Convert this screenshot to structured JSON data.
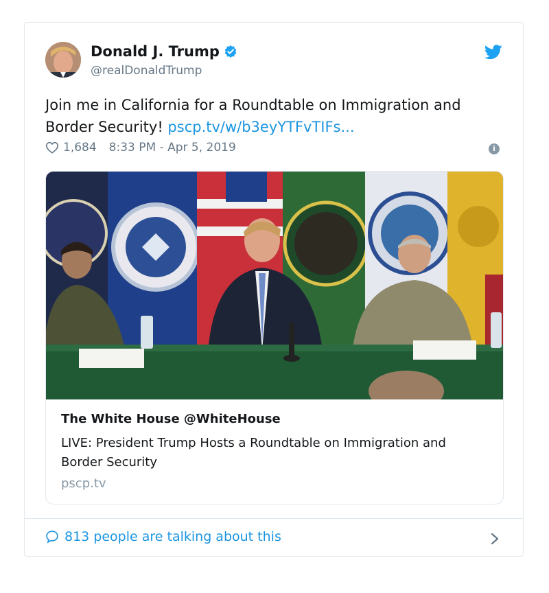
{
  "tweet": {
    "author_name": "Donald J. Trump",
    "handle": "@realDonaldTrump",
    "text": "Join me in California for a Roundtable on Immigration and Border Security! ",
    "link_text": "pscp.tv/w/b3eyYTFvTIFs...",
    "likes": "1,684",
    "timestamp": "8:33 PM - Apr 5, 2019"
  },
  "card": {
    "title": "The White House @WhiteHouse",
    "description": "LIVE: President Trump Hosts a Roundtable on Immigration and Border Security",
    "domain": "pscp.tv"
  },
  "footer": {
    "conversation": "813 people are talking about this"
  },
  "colors": {
    "twitter_blue": "#1da1f2",
    "link_blue": "#1b95e0",
    "secondary_gray": "#657786",
    "border": "#e1e8ed"
  },
  "icons": [
    "verified-badge-icon",
    "twitter-bird-icon",
    "heart-icon",
    "info-icon",
    "speech-bubble-icon",
    "chevron-right-icon"
  ]
}
